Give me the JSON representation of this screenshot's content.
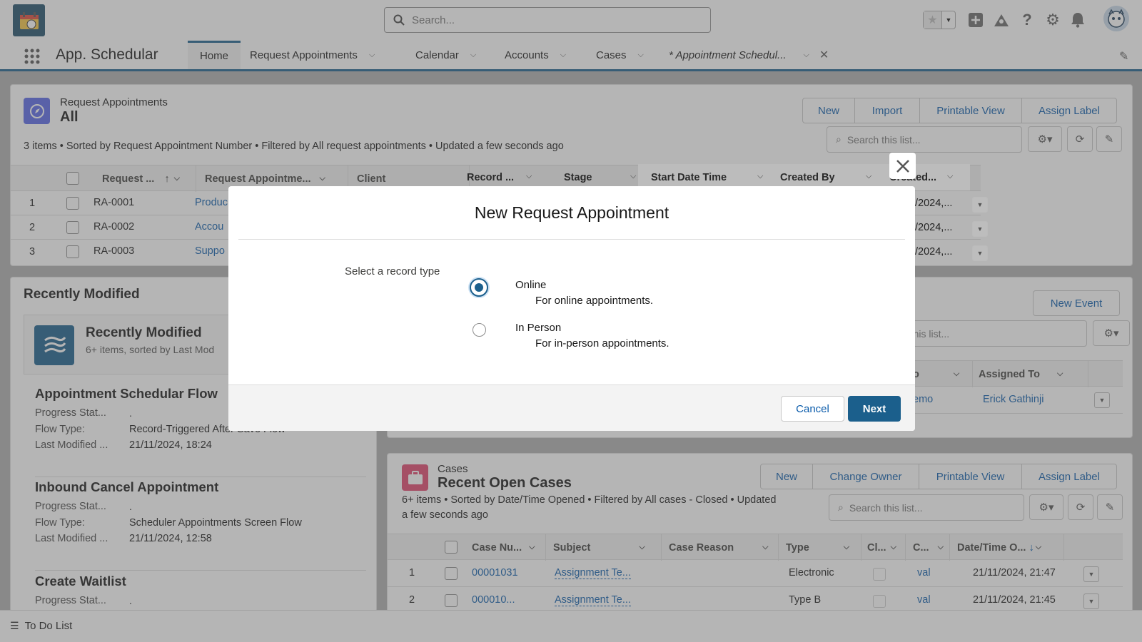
{
  "header": {
    "search_placeholder": "Search...",
    "icons": [
      "favorites-icon",
      "add-icon",
      "trailhead-icon",
      "help-icon",
      "setup-gear-icon",
      "notifications-bell-icon",
      "user-avatar"
    ]
  },
  "nav": {
    "app_name": "App. Schedular",
    "tabs": [
      {
        "label": "Home",
        "active": true
      },
      {
        "label": "Request Appointments"
      },
      {
        "label": "Calendar"
      },
      {
        "label": "Accounts"
      },
      {
        "label": "Cases"
      },
      {
        "label": "* Appointment Schedul..."
      }
    ]
  },
  "request_list": {
    "object": "Request Appointments",
    "view": "All",
    "buttons": [
      "New",
      "Import",
      "Printable View",
      "Assign Label"
    ],
    "search_placeholder": "Search this list...",
    "meta": "3 items • Sorted by Request Appointment Number • Filtered by All request appointments • Updated a few seconds ago",
    "columns": [
      "Request ...",
      "Request Appointme...",
      "Client",
      "Record ...",
      "Stage",
      "Start Date Time",
      "Created By",
      "Created..."
    ],
    "rows": [
      {
        "num": "1",
        "id": "RA-0001",
        "name": "Produc",
        "created": "/2024,..."
      },
      {
        "num": "2",
        "id": "RA-0002",
        "name": "Accou",
        "created": "/2024,..."
      },
      {
        "num": "3",
        "id": "RA-0003",
        "name": "Suppo",
        "created": "/2024,..."
      }
    ]
  },
  "recently_modified": {
    "section_title": "Recently Modified",
    "card_title": "Recently Modified",
    "card_meta": "6+ items, sorted by Last Mod",
    "items": [
      {
        "title": "Appointment Schedular Flow",
        "progress_label": "Progress Stat...",
        "progress_value": ".",
        "type_label": "Flow Type:",
        "type_value": "Record-Triggered After Save Flow",
        "modified_label": "Last Modified ...",
        "modified_value": "21/11/2024, 18:24"
      },
      {
        "title": "Inbound Cancel Appointment",
        "progress_label": "Progress Stat...",
        "progress_value": ".",
        "type_label": "Flow Type:",
        "type_value": "Scheduler Appointments Screen Flow",
        "modified_label": "Last Modified ...",
        "modified_value": "21/11/2024, 12:58"
      },
      {
        "title": "Create Waitlist",
        "progress_label": "Progress Stat...",
        "progress_value": "."
      }
    ]
  },
  "events": {
    "new_event": "New Event",
    "search_placeholder": "h this list...",
    "col_to": "o",
    "col_assigned": "Assigned To",
    "row_to": "emo",
    "row_assigned": "Erick Gathinji"
  },
  "cases": {
    "object": "Cases",
    "view": "Recent Open Cases",
    "buttons": [
      "New",
      "Change Owner",
      "Printable View",
      "Assign Label"
    ],
    "meta_line1": "6+ items • Sorted by Date/Time Opened • Filtered by All cases - Closed • Updated",
    "meta_line2": "a few seconds ago",
    "search_placeholder": "Search this list...",
    "columns": [
      "Case Nu...",
      "Subject",
      "Case Reason",
      "Type",
      "Cl...",
      "C...",
      "Date/Time O..."
    ],
    "rows": [
      {
        "num": "1",
        "case": "00001031",
        "subject": "Assignment Te...",
        "type": "Electronic",
        "c": "val",
        "date": "21/11/2024, 21:47"
      },
      {
        "num": "2",
        "case": "000010...",
        "subject": "Assignment Te...",
        "type": "Type B",
        "c": "val",
        "date": "21/11/2024, 21:45"
      }
    ]
  },
  "utility_bar": {
    "todo": "To Do List"
  },
  "modal": {
    "title": "New Request Appointment",
    "prompt": "Select a record type",
    "options": [
      {
        "label": "Online",
        "description": "For online appointments.",
        "selected": true
      },
      {
        "label": "In Person",
        "description": "For in-person appointments.",
        "selected": false
      }
    ],
    "cancel": "Cancel",
    "next": "Next"
  },
  "colors": {
    "brand": "#1b5f8c",
    "link": "#0b5cab",
    "event_icon": "#5867e8",
    "cases_icon": "#e2466e"
  }
}
